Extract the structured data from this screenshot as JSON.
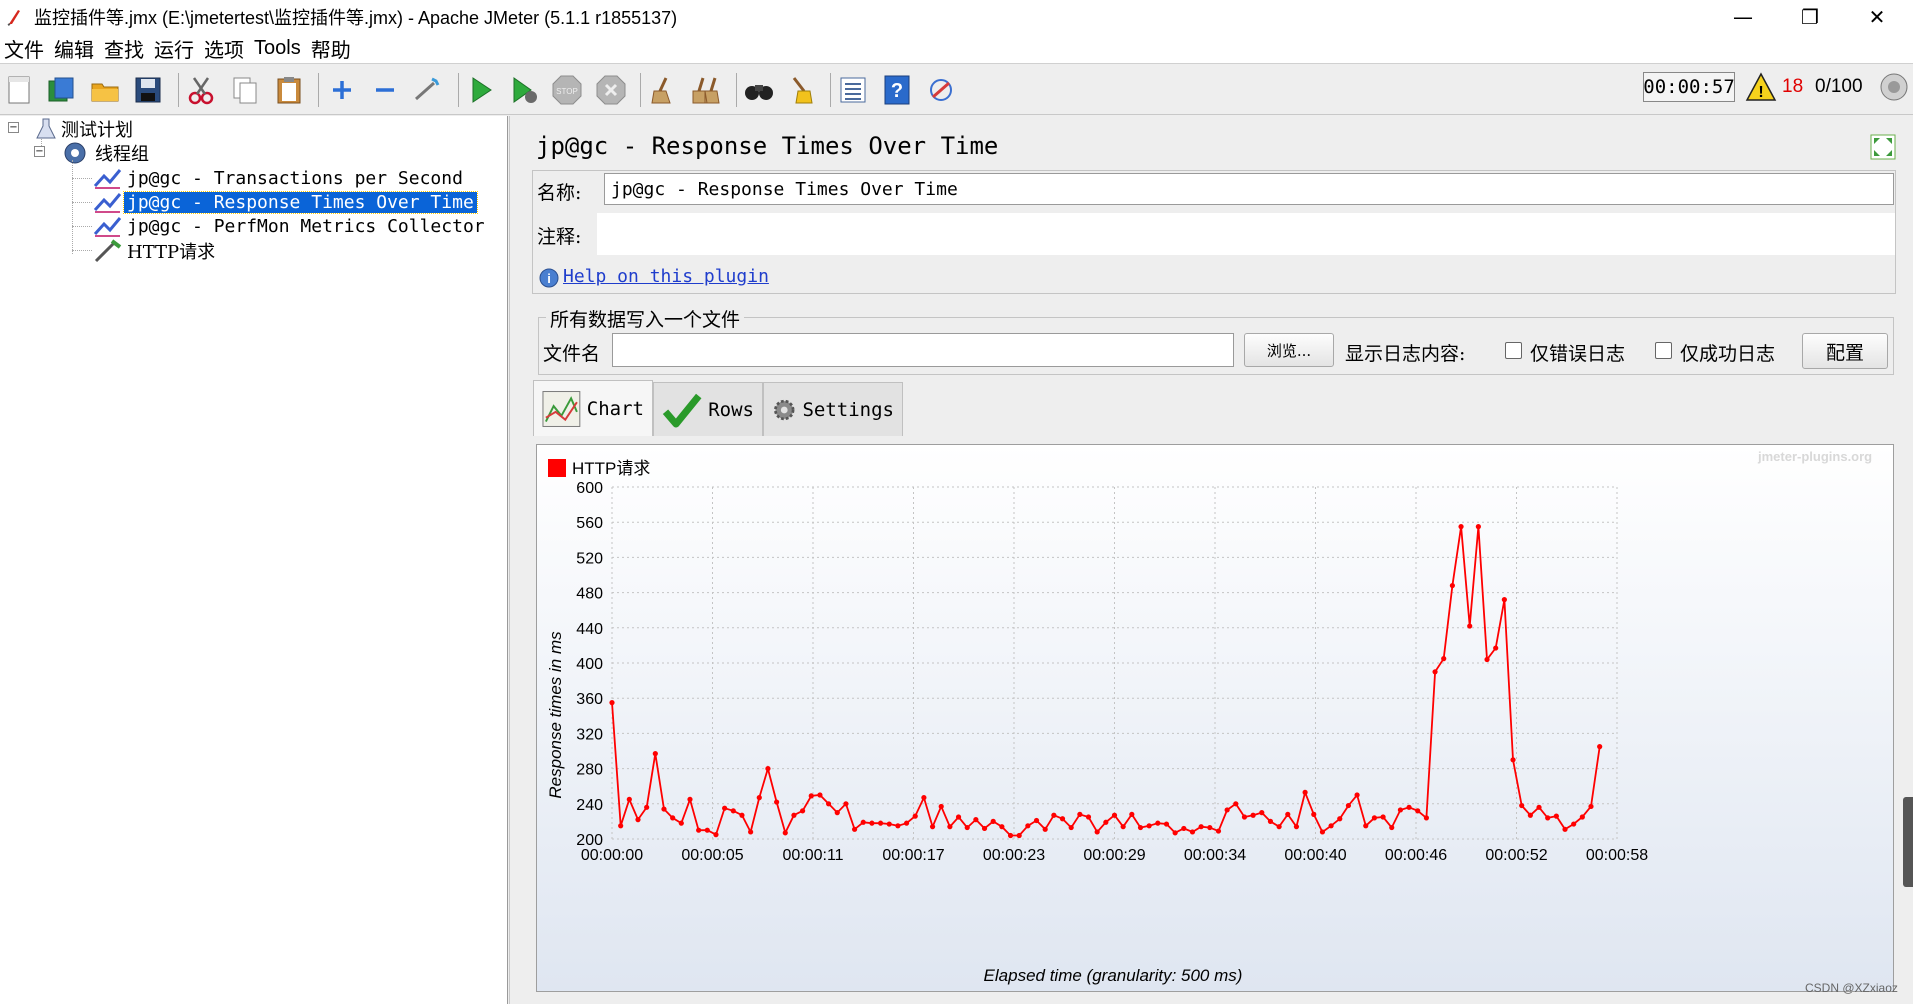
{
  "window": {
    "title": "监控插件等.jmx (E:\\jmetertest\\监控插件等.jmx) - Apache JMeter (5.1.1 r1855137)",
    "controls": [
      "—",
      "❐",
      "✕"
    ]
  },
  "menu": [
    "文件",
    "编辑",
    "查找",
    "运行",
    "选项",
    "Tools",
    "帮助"
  ],
  "toolbar": {
    "elapsed": "00:00:57",
    "error_count": "18",
    "threads": "0/100"
  },
  "tree": {
    "plan": "测试计划",
    "thread_group": "线程组",
    "items": [
      "jp@gc - Transactions per Second",
      "jp@gc - Response Times Over Time",
      "jp@gc - PerfMon Metrics Collector",
      "HTTP请求"
    ]
  },
  "panel": {
    "title": "jp@gc - Response Times Over Time",
    "name_label": "名称:",
    "name_value": "jp@gc - Response Times Over Time",
    "comment_label": "注释:",
    "comment_value": "",
    "help_link": "Help on this plugin",
    "file_group_title": "所有数据写入一个文件",
    "file_label": "文件名",
    "file_value": "",
    "browse_button": "浏览...",
    "log_label": "显示日志内容:",
    "errors_only": "仅错误日志",
    "success_only": "仅成功日志",
    "config_button": "配置"
  },
  "tabs": [
    "Chart",
    "Rows",
    "Settings"
  ],
  "watermark": "jmeter-plugins.org",
  "credit": "CSDN @XZxiaoz",
  "colors": {
    "series": "#ff0000",
    "selection": "#0a64d8"
  },
  "chart_data": {
    "type": "line",
    "legend": [
      "HTTP请求"
    ],
    "xlabel": "Elapsed time (granularity: 500 ms)",
    "ylabel": "Response times in ms",
    "ylim": [
      200,
      600
    ],
    "yticks": [
      200,
      240,
      280,
      320,
      360,
      400,
      440,
      480,
      520,
      560,
      600
    ],
    "xticks": [
      "00:00:00",
      "00:00:05",
      "00:00:11",
      "00:00:17",
      "00:00:23",
      "00:00:29",
      "00:00:34",
      "00:00:40",
      "00:00:46",
      "00:00:52",
      "00:00:58"
    ],
    "xlim_s": [
      0,
      58
    ],
    "series": [
      {
        "name": "HTTP请求",
        "x_s": [
          0,
          0.5,
          1,
          1.5,
          2,
          2.5,
          3,
          3.5,
          4,
          4.5,
          5,
          5.5,
          6,
          6.5,
          7,
          7.5,
          8,
          8.5,
          9,
          9.5,
          10,
          10.5,
          11,
          11.5,
          12,
          12.5,
          13,
          13.5,
          14,
          14.5,
          15,
          15.5,
          16,
          16.5,
          17,
          17.5,
          18,
          18.5,
          19,
          19.5,
          20,
          20.5,
          21,
          21.5,
          22,
          22.5,
          23,
          23.5,
          24,
          24.5,
          25,
          25.5,
          26,
          26.5,
          27,
          27.5,
          28,
          28.5,
          29,
          29.5,
          30,
          30.5,
          31,
          31.5,
          32,
          32.5,
          33,
          33.5,
          34,
          34.5,
          35,
          35.5,
          36,
          36.5,
          37,
          37.5,
          38,
          38.5,
          39,
          39.5,
          40,
          40.5,
          41,
          41.5,
          42,
          42.5,
          43,
          43.5,
          44,
          44.5,
          45,
          45.5,
          46,
          46.5,
          47,
          47.5,
          48,
          48.5,
          49,
          49.5,
          50,
          50.5,
          51,
          51.5,
          52,
          52.5,
          53,
          53.5,
          54,
          54.5,
          55,
          55.5,
          56,
          56.5,
          57,
          57.5,
          58
        ],
        "values": [
          355,
          215,
          245,
          222,
          236,
          297,
          234,
          224,
          218,
          245,
          210,
          210,
          205,
          235,
          232,
          227,
          208,
          247,
          280,
          242,
          207,
          227,
          232,
          249,
          250,
          240,
          230,
          240,
          211,
          219,
          218,
          218,
          217,
          215,
          218,
          226,
          247,
          214,
          237,
          214,
          225,
          213,
          222,
          212,
          220,
          214,
          204,
          204,
          215,
          221,
          211,
          227,
          223,
          213,
          228,
          225,
          208,
          219,
          227,
          214,
          228,
          213,
          215,
          218,
          217,
          207,
          212,
          208,
          214,
          213,
          209,
          233,
          240,
          225,
          227,
          230,
          220,
          214,
          228,
          214,
          253,
          228,
          208,
          215,
          223,
          238,
          250,
          215,
          224,
          225,
          213,
          233,
          236,
          232,
          224,
          390,
          405,
          488,
          555,
          442,
          555,
          404,
          417,
          472,
          290,
          238,
          227,
          236,
          224,
          226,
          211,
          217,
          225,
          237,
          305
        ]
      }
    ]
  }
}
